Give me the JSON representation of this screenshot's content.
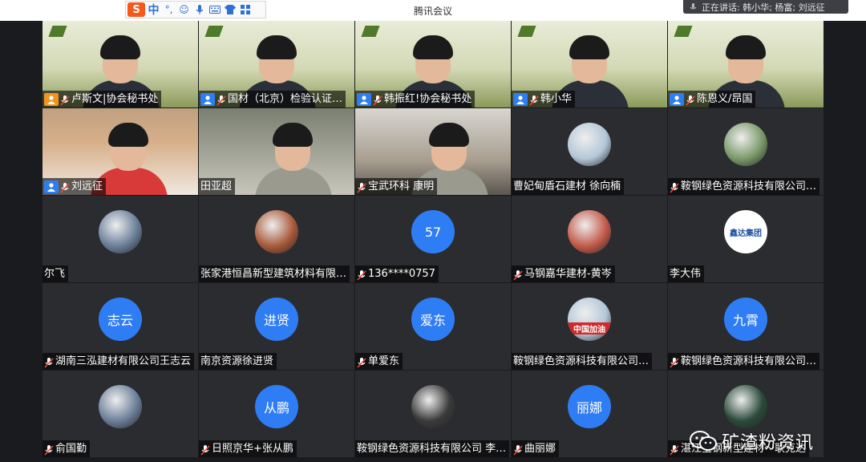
{
  "ime": {
    "logo": "S",
    "lang": "中",
    "items": [
      "°,",
      "☺",
      "mic-icon",
      "keyboard-icon",
      "shirt-icon",
      "grid-icon"
    ]
  },
  "window": {
    "title": "腾讯会议"
  },
  "speaking": {
    "text": "正在讲话: 韩小华; 杨富; 刘远征"
  },
  "participants": [
    {
      "name": "卢斯文|协会秘书处",
      "badge": "host",
      "type": "video"
    },
    {
      "name": "国材（北京）检验认证…",
      "badge": "user",
      "type": "video"
    },
    {
      "name": "韩振红!协会秘书处",
      "badge": "user",
      "type": "video"
    },
    {
      "name": "韩小华",
      "badge": "user",
      "type": "video"
    },
    {
      "name": "陈恩义/昂国",
      "badge": "user",
      "type": "video"
    },
    {
      "name": "刘远征",
      "badge": "user",
      "type": "video"
    },
    {
      "name": "田亚超",
      "badge": "none",
      "type": "video"
    },
    {
      "name": "宝武环科 康明",
      "badge": "muted",
      "type": "video"
    },
    {
      "name": "曹妃甸盾石建材 徐向楠",
      "badge": "none",
      "type": "avatar-photo"
    },
    {
      "name": "鞍钢绿色资源科技有限公司…",
      "badge": "muted",
      "type": "avatar-photo"
    },
    {
      "name": "尔飞",
      "badge": "none",
      "type": "avatar-photo"
    },
    {
      "name": "张家港恒昌新型建筑材料有限…",
      "badge": "none",
      "type": "avatar-photo"
    },
    {
      "name": "136****0757",
      "badge": "muted",
      "type": "avatar-initial",
      "initial": "57"
    },
    {
      "name": "马钢嘉华建材-黄岑",
      "badge": "muted",
      "type": "avatar-photo"
    },
    {
      "name": "李大伟",
      "badge": "none",
      "type": "avatar-logo",
      "logo": "鑫达集团"
    },
    {
      "name": "湖南三泓建材有限公司王志云",
      "badge": "muted",
      "type": "avatar-initial",
      "initial": "志云"
    },
    {
      "name": "南京资源徐进贤",
      "badge": "none",
      "type": "avatar-initial",
      "initial": "进贤"
    },
    {
      "name": "单爱东",
      "badge": "muted",
      "type": "avatar-initial",
      "initial": "爱东"
    },
    {
      "name": "鞍钢绿色资源科技有限公司…",
      "badge": "none",
      "type": "avatar-photo",
      "caption": "中国加油"
    },
    {
      "name": "鞍钢绿色资源科技有限公司…",
      "badge": "muted",
      "type": "avatar-initial",
      "initial": "九霄"
    },
    {
      "name": "俞国勤",
      "badge": "muted",
      "type": "avatar-photo"
    },
    {
      "name": "日照京华+张从鹏",
      "badge": "muted",
      "type": "avatar-initial",
      "initial": "从鹏"
    },
    {
      "name": "鞍钢绿色资源科技有限公司 李…",
      "badge": "none",
      "type": "avatar-photo"
    },
    {
      "name": "曲丽娜",
      "badge": "muted",
      "type": "avatar-initial",
      "initial": "丽娜"
    },
    {
      "name": "湛江宝钢新型建材～耿克达",
      "badge": "muted",
      "type": "avatar-photo"
    }
  ],
  "watermark": {
    "text": "矿渣粉资讯"
  },
  "colors": {
    "accent": "#2f7df5",
    "host": "#f29320",
    "muted": "#e74c3c",
    "stage": "#1a1b1e"
  }
}
